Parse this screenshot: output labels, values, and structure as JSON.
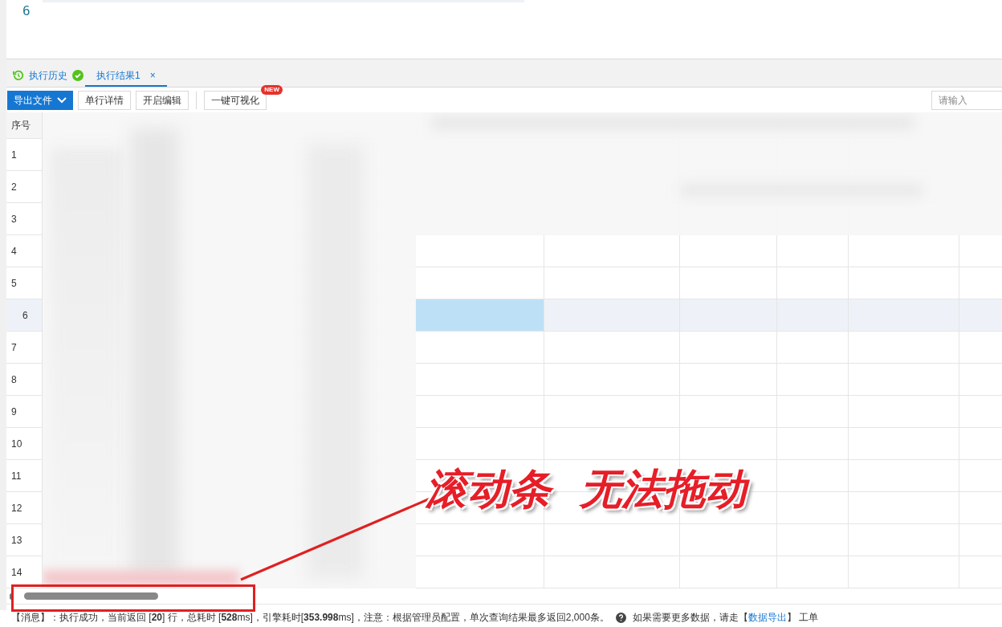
{
  "editor": {
    "line_number": "6"
  },
  "tabs": [
    {
      "kind": "history",
      "label": "执行历史",
      "selected": false
    },
    {
      "kind": "result",
      "label": "执行结果1",
      "selected": true,
      "close": "×"
    }
  ],
  "toolbar": {
    "buttons": [
      {
        "kind": "dropdown",
        "label": "导出文件"
      },
      {
        "kind": "plain",
        "label": "单行详情"
      },
      {
        "kind": "plain",
        "label": "开启编辑"
      },
      {
        "kind": "badge",
        "label": "一键可视化",
        "badge": "NEW"
      }
    ],
    "search": {
      "placeholder": "请输入"
    }
  },
  "table": {
    "index_header": "序号",
    "rows": [
      {
        "number": "1",
        "selected": false
      },
      {
        "number": "2",
        "selected": false
      },
      {
        "number": "3",
        "selected": false
      },
      {
        "number": "4",
        "selected": false
      },
      {
        "number": "5",
        "selected": false
      },
      {
        "number": "6",
        "selected": true
      },
      {
        "number": "7",
        "selected": false
      },
      {
        "number": "8",
        "selected": false
      },
      {
        "number": "9",
        "selected": false
      },
      {
        "number": "10",
        "selected": false
      },
      {
        "number": "11",
        "selected": false
      },
      {
        "number": "12",
        "selected": false
      },
      {
        "number": "13",
        "selected": false
      },
      {
        "number": "14",
        "selected": false
      }
    ]
  },
  "status_bar": {
    "message": "【消息】：执行成功，当前返回 [**20**] 行，总耗时 [**528**ms]，引擎耗时[**353.998**ms]，注意：根据管理员配置，单次查询结果最多返回2,000条。",
    "hint_prefix": "如果需要更多数据，请走【",
    "link": "数据导出",
    "hint_suffix": "】 工单"
  },
  "annotation": {
    "text": "滚动条  无法拖动"
  }
}
